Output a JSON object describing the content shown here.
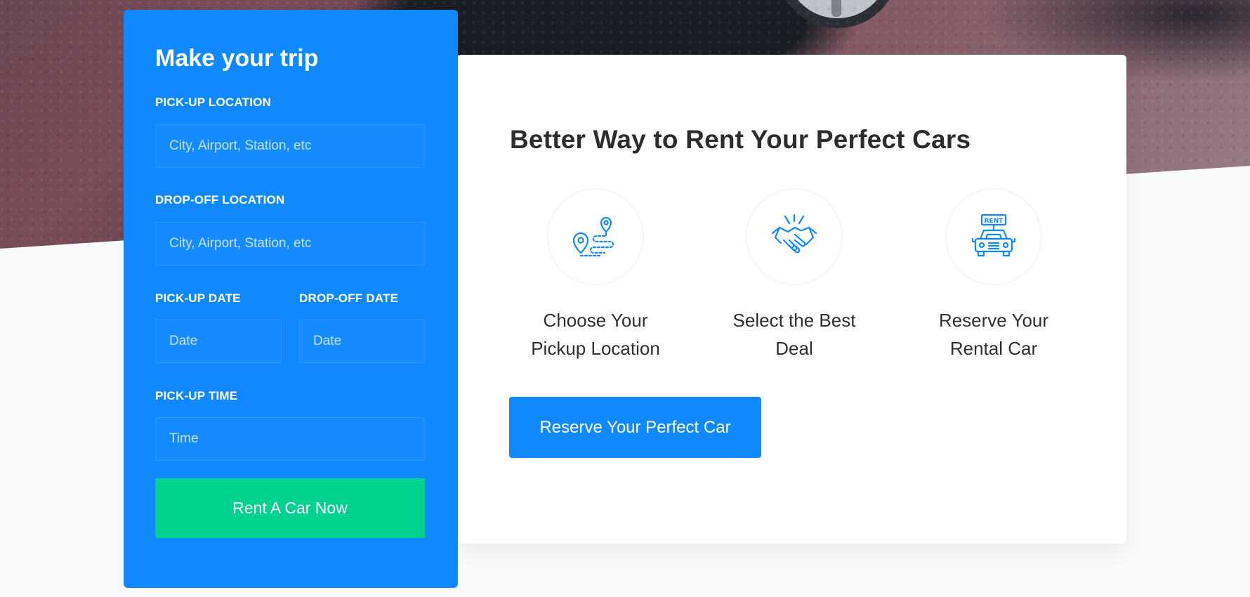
{
  "booking_form": {
    "title": "Make your trip",
    "pickup_location": {
      "label": "PICK-UP LOCATION",
      "placeholder": "City, Airport, Station, etc"
    },
    "dropoff_location": {
      "label": "DROP-OFF LOCATION",
      "placeholder": "City, Airport, Station, etc"
    },
    "pickup_date": {
      "label": "PICK-UP DATE",
      "placeholder": "Date"
    },
    "dropoff_date": {
      "label": "DROP-OFF DATE",
      "placeholder": "Date"
    },
    "pickup_time": {
      "label": "PICK-UP TIME",
      "placeholder": "Time"
    },
    "submit_label": "Rent A Car Now"
  },
  "services": {
    "title": "Better Way to Rent Your Perfect Cars",
    "features": [
      {
        "icon": "route-location-icon",
        "label": "Choose Your Pickup Location"
      },
      {
        "icon": "handshake-icon",
        "label": "Select the Best Deal"
      },
      {
        "icon": "rent-car-icon",
        "label": "Reserve Your Rental Car"
      }
    ],
    "cta_label": "Reserve Your Perfect Car"
  },
  "colors": {
    "primary": "#1089ff",
    "accent_green": "#01d28e",
    "heading": "#2d2d2d",
    "background": "#f8f9fa"
  }
}
